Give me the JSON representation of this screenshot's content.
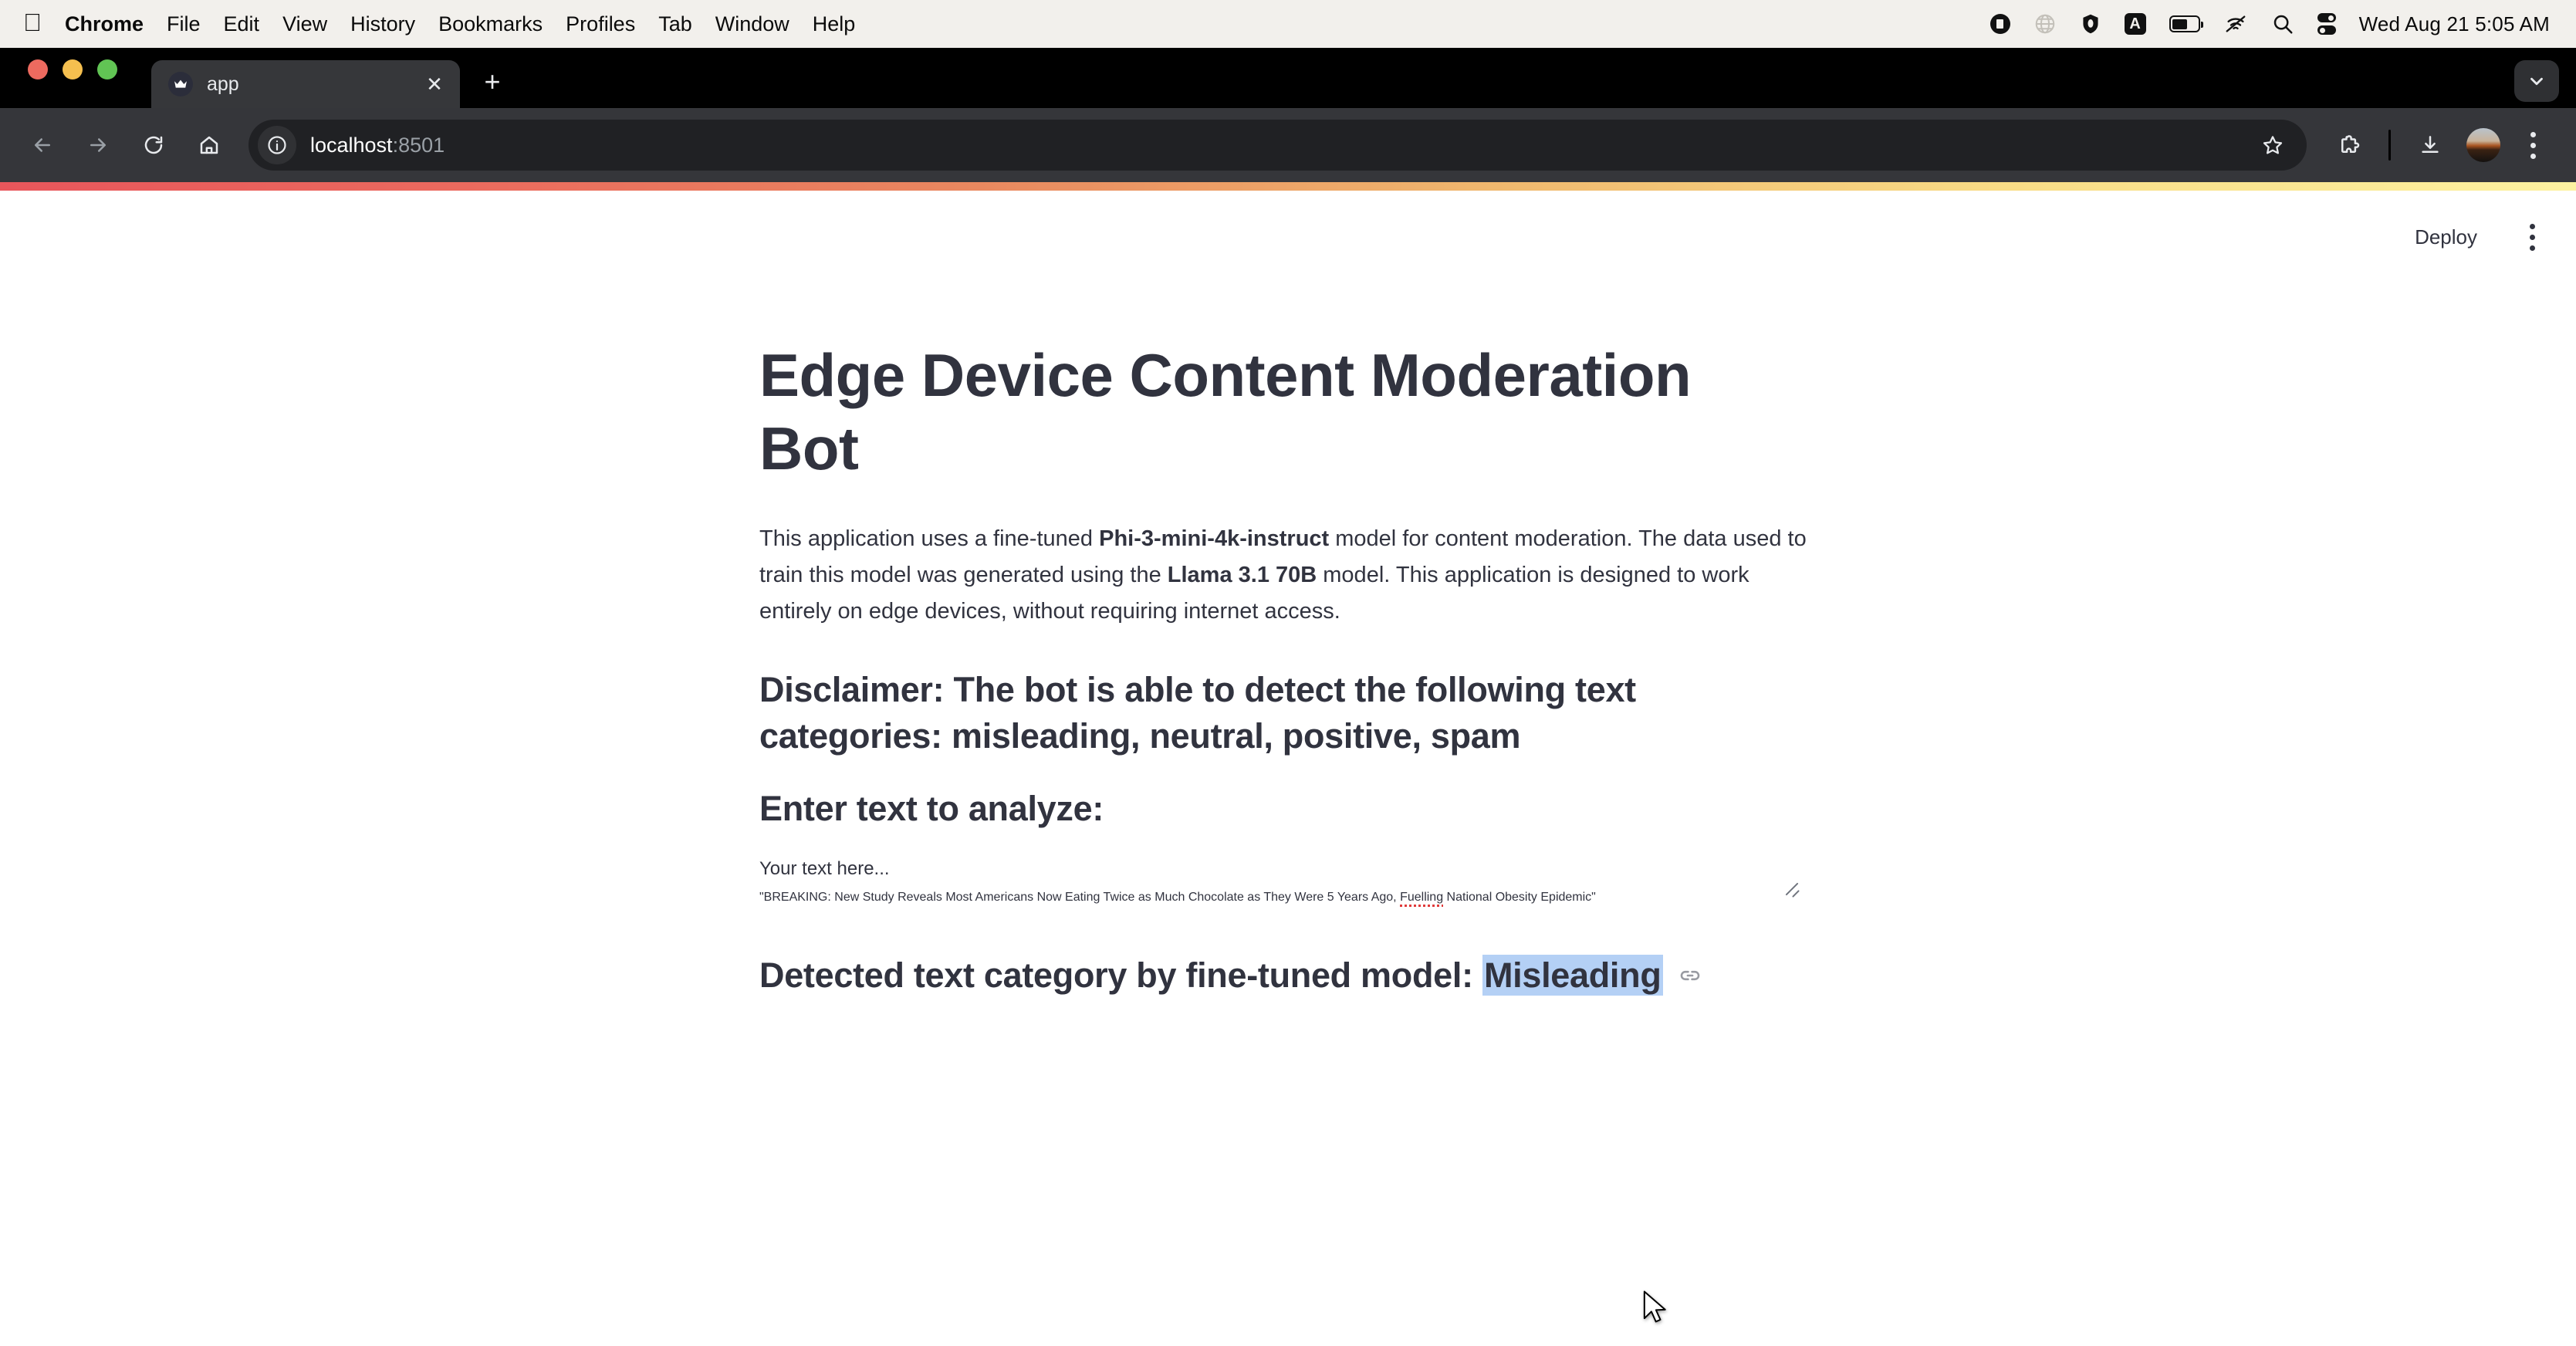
{
  "menubar": {
    "apple_icon": "apple-logo",
    "items": [
      {
        "label": "Chrome",
        "bold": true
      },
      {
        "label": "File",
        "bold": false
      },
      {
        "label": "Edit",
        "bold": false
      },
      {
        "label": "View",
        "bold": false
      },
      {
        "label": "History",
        "bold": false
      },
      {
        "label": "Bookmarks",
        "bold": false
      },
      {
        "label": "Profiles",
        "bold": false
      },
      {
        "label": "Tab",
        "bold": false
      },
      {
        "label": "Window",
        "bold": false
      },
      {
        "label": "Help",
        "bold": false
      }
    ],
    "status_icons": [
      "screen-record-icon",
      "globe-icon",
      "vpn-shield-icon",
      "character-input-a-icon",
      "battery-icon",
      "wifi-off-icon",
      "spotlight-search-icon",
      "control-center-icon"
    ],
    "clock": "Wed Aug 21  5:05 AM"
  },
  "browser": {
    "tab": {
      "title": "app",
      "favicon": "streamlit-crown-icon",
      "close_icon": "close-icon"
    },
    "new_tab_icon": "plus-icon",
    "tab_search_icon": "chevron-down-icon",
    "nav": {
      "back_icon": "arrow-left-icon",
      "forward_icon": "arrow-right-icon",
      "reload_icon": "reload-icon",
      "home_icon": "home-icon"
    },
    "omnibox": {
      "site_info_icon": "info-circle-icon",
      "url_host": "localhost",
      "url_port": ":8501",
      "bookmark_icon": "star-icon"
    },
    "actions": {
      "extensions_icon": "puzzle-piece-icon",
      "downloads_icon": "download-icon",
      "profile_icon": "avatar",
      "menu_icon": "three-dots-vertical-icon"
    },
    "loading_bar_colors": {
      "start": "#e8565b",
      "end": "#fdf2a0"
    }
  },
  "app": {
    "header": {
      "deploy_label": "Deploy",
      "menu_icon": "three-dots-vertical-icon"
    },
    "title": "Edge Device Content Moderation Bot",
    "intro": {
      "part1": "This application uses a fine-tuned ",
      "bold1": "Phi-3-mini-4k-instruct",
      "part2": " model for content moderation. The data used to train this model was generated using the ",
      "bold2": "Llama 3.1 70B",
      "part3": " model. This application is designed to work entirely on edge devices, without requiring internet access."
    },
    "disclaimer": "Disclaimer: The bot is able to detect the following text categories: misleading, neutral, positive, spam",
    "input_heading": "Enter text to analyze:",
    "textarea": {
      "label": "Your text here...",
      "placeholder": "Your text here...",
      "value_line1": "\"BREAKING: New Study Reveals Most Americans Now Eating Twice as Much Chocolate as They Were 5 Years Ago, ",
      "value_misspelled": "Fuelling",
      "value_line2": " National Obesity Epidemic\"",
      "resize_handle": "resize-grip-icon"
    },
    "result": {
      "prefix": "Detected text category by fine-tuned model: ",
      "category": "Misleading",
      "anchor_icon": "link-icon",
      "selection_color": "#b4d0f5"
    },
    "theme": {
      "text_color": "#31333f",
      "input_bg": "#eef1f5",
      "background": "#ffffff"
    }
  }
}
